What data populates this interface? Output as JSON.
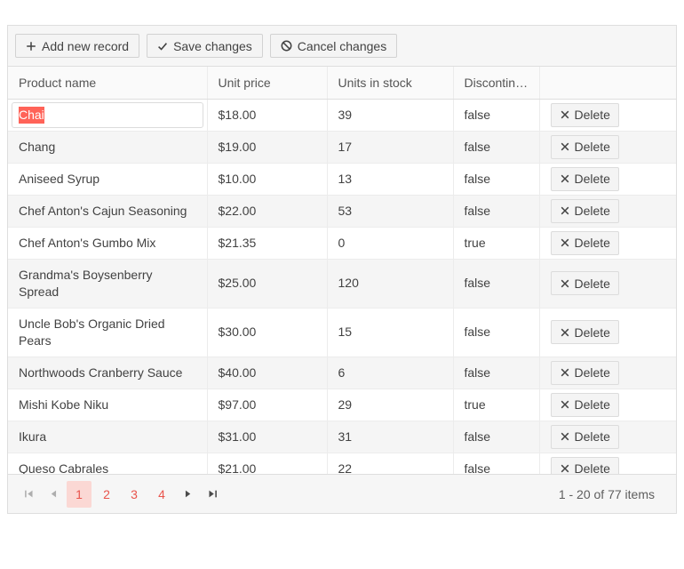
{
  "colors": {
    "primary": "#ff6358",
    "pager_link": "#e9544c",
    "pager_active_bg": "#fbd8d4",
    "toolbar_bg": "#f6f6f6",
    "header_bg": "#fafafa",
    "alt_row_bg": "#f5f5f5",
    "grid_border": "#dedede",
    "cell_border": "#ececec",
    "button_bg": "#f4f4f4",
    "button_border": "#d2d2d2",
    "text": "#424242",
    "muted_text": "#5e5e5e"
  },
  "toolbar": {
    "add_label": "Add new record",
    "save_label": "Save changes",
    "cancel_label": "Cancel changes"
  },
  "icons": {
    "add": "plus-icon",
    "save": "check-icon",
    "cancel": "slashed-circle-icon",
    "delete": "x-icon",
    "pager": [
      "seek-to-first-icon",
      "previous-page-icon",
      "next-page-icon",
      "seek-to-end-icon"
    ]
  },
  "grid": {
    "columns": [
      {
        "label": "Product name"
      },
      {
        "label": "Unit price"
      },
      {
        "label": "Units in stock"
      },
      {
        "label": "Discontinued"
      },
      {
        "label": ""
      }
    ],
    "delete_label": "Delete",
    "editing": {
      "row": 0,
      "column": "Product name",
      "value": "Chai",
      "selected_text": "Chai"
    },
    "rows": [
      {
        "product": "Chai",
        "unit_price": "$18.00",
        "units_in_stock": "39",
        "discontinued": "false",
        "editing": true
      },
      {
        "product": "Chang",
        "unit_price": "$19.00",
        "units_in_stock": "17",
        "discontinued": "false"
      },
      {
        "product": "Aniseed Syrup",
        "unit_price": "$10.00",
        "units_in_stock": "13",
        "discontinued": "false"
      },
      {
        "product": "Chef Anton's Cajun Seasoning",
        "unit_price": "$22.00",
        "units_in_stock": "53",
        "discontinued": "false"
      },
      {
        "product": "Chef Anton's Gumbo Mix",
        "unit_price": "$21.35",
        "units_in_stock": "0",
        "discontinued": "true"
      },
      {
        "product": "Grandma's Boysenberry Spread",
        "unit_price": "$25.00",
        "units_in_stock": "120",
        "discontinued": "false"
      },
      {
        "product": "Uncle Bob's Organic Dried Pears",
        "unit_price": "$30.00",
        "units_in_stock": "15",
        "discontinued": "false"
      },
      {
        "product": "Northwoods Cranberry Sauce",
        "unit_price": "$40.00",
        "units_in_stock": "6",
        "discontinued": "false"
      },
      {
        "product": "Mishi Kobe Niku",
        "unit_price": "$97.00",
        "units_in_stock": "29",
        "discontinued": "true"
      },
      {
        "product": "Ikura",
        "unit_price": "$31.00",
        "units_in_stock": "31",
        "discontinued": "false"
      },
      {
        "product": "Queso Cabrales",
        "unit_price": "$21.00",
        "units_in_stock": "22",
        "discontinued": "false"
      }
    ]
  },
  "pager": {
    "pages": [
      "1",
      "2",
      "3",
      "4"
    ],
    "current_page": "1",
    "info": "1 - 20 of 77 items"
  }
}
